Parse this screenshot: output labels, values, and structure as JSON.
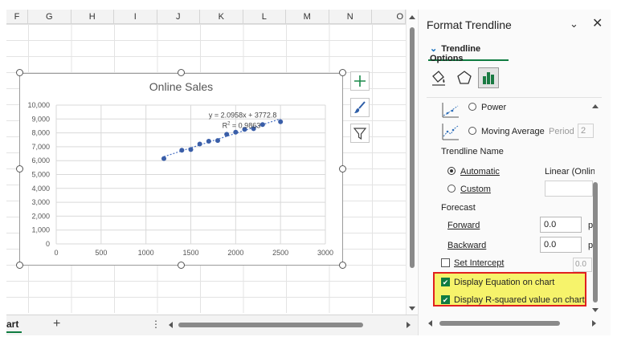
{
  "sheet": {
    "columns": [
      "F",
      "G",
      "H",
      "I",
      "J",
      "K",
      "L",
      "M",
      "N",
      "O"
    ],
    "tab_label": "art",
    "add_sheet": "+",
    "more": "⋮"
  },
  "chart_data": {
    "type": "scatter",
    "title": "Online Sales",
    "xlabel": "",
    "ylabel": "",
    "xlim": [
      0,
      3000
    ],
    "ylim": [
      0,
      10000
    ],
    "x_ticks": [
      "0",
      "500",
      "1000",
      "1500",
      "2000",
      "2500",
      "3000"
    ],
    "y_ticks": [
      "0",
      "1,000",
      "2,000",
      "3,000",
      "4,000",
      "5,000",
      "6,000",
      "7,000",
      "8,000",
      "9,000",
      "10,000"
    ],
    "grid": true,
    "x": [
      1200,
      1400,
      1500,
      1600,
      1700,
      1800,
      1900,
      2000,
      2100,
      2200,
      2300,
      2500
    ],
    "y": [
      6150,
      6750,
      6800,
      7200,
      7400,
      7450,
      7900,
      8050,
      8250,
      8300,
      8600,
      8800
    ],
    "trendline": {
      "type": "linear",
      "slope": 2.0958,
      "intercept": 3772.8,
      "x_range": [
        1200,
        2500
      ]
    },
    "equation_label": "y = 2.0958x + 3772.8",
    "r2_label_prefix": "R",
    "r2_label_sup": "2",
    "r2_label_value": " = 0.9863",
    "point_color": "#3a5ea8",
    "trendline_color": "#4a72c4"
  },
  "chart_buttons": {
    "elements": "chart-elements",
    "styles": "chart-styles",
    "filters": "chart-filters"
  },
  "pane": {
    "title": "Format Trendline",
    "collapse_glyph": "⌄",
    "close_glyph": "✕",
    "section_tab": "Trendline Options",
    "section_chevron": "⌄",
    "options": {
      "power": "Power",
      "moving_average": "Moving Average",
      "period_label": "Period",
      "period_value": "2"
    },
    "trendline_name": {
      "heading": "Trendline Name",
      "automatic": "Automatic",
      "automatic_value": "Linear (Online",
      "custom": "Custom"
    },
    "forecast": {
      "heading": "Forecast",
      "forward_label": "Forward",
      "forward_value": "0.0",
      "backward_label": "Backward",
      "backward_value": "0.0",
      "unit": "p"
    },
    "set_intercept": {
      "label": "Set Intercept",
      "value": "0.0"
    },
    "display_equation": {
      "label": "Display Equation on chart",
      "checked": true
    },
    "display_r2": {
      "label": "Display R-squared value on chart",
      "checked": true
    },
    "accent_color": "#107c41",
    "highlight_color": "#f6f36b",
    "highlight_border": "#e02020"
  }
}
